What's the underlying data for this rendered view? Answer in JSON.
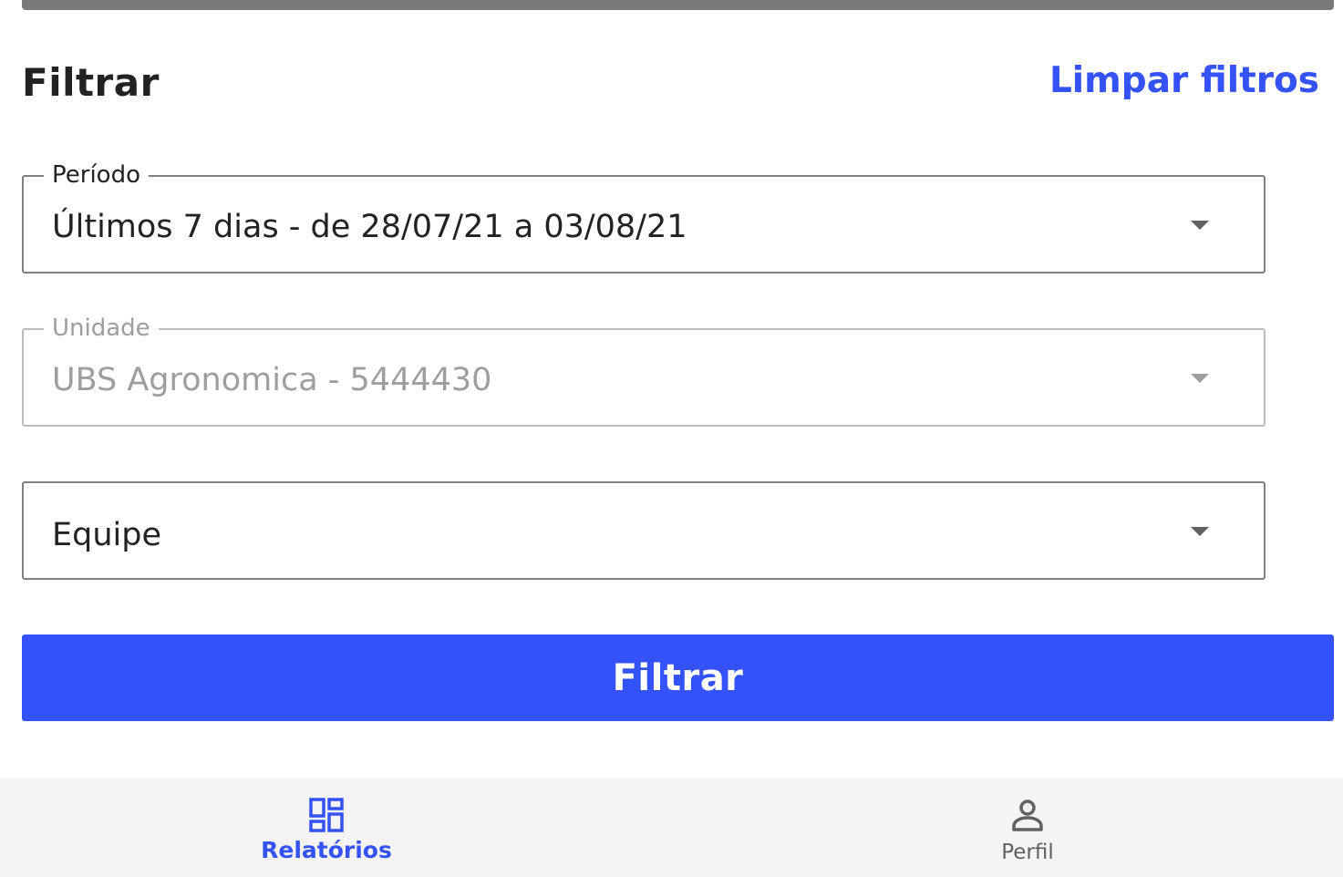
{
  "header": {
    "title": "Filtrar",
    "clear_label": "Limpar filtros"
  },
  "fields": {
    "periodo": {
      "label": "Período",
      "value": "Últimos 7 dias - de 28/07/21 a 03/08/21"
    },
    "unidade": {
      "label": "Unidade",
      "value": "UBS Agronomica - 5444430",
      "disabled": true
    },
    "equipe": {
      "placeholder": "Equipe"
    }
  },
  "actions": {
    "filter_label": "Filtrar"
  },
  "bottom_nav": {
    "items": [
      {
        "label": "Relatórios",
        "icon": "dashboard-icon",
        "active": true
      },
      {
        "label": "Perfil",
        "icon": "person-icon",
        "active": false
      }
    ]
  },
  "colors": {
    "accent": "#3452f5",
    "button": "#3452fc",
    "nav_background": "#f4f4f4"
  }
}
